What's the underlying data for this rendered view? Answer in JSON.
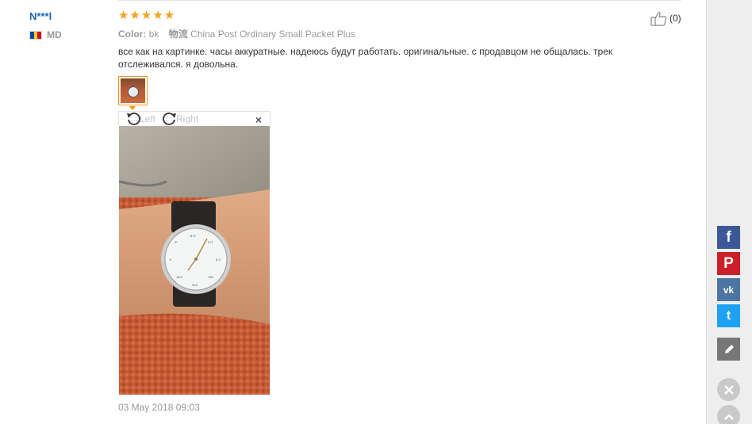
{
  "buyer": {
    "name": "N***l",
    "country_code": "MD",
    "flag_colors": [
      "#0046ae",
      "#ffd200",
      "#cc092f"
    ]
  },
  "review": {
    "rating": 5,
    "stars": [
      "★",
      "★",
      "★",
      "★",
      "★"
    ],
    "color_label": "Color:",
    "color_value": "bk",
    "shipping_label": "物流",
    "shipping_value": "China Post Ordinary Small Packet Plus",
    "text": "все как на картинке. часы аккуратные. надеюсь будут работать. оригинальные. с продавцом не общалась. трек отслеживался. я довольна.",
    "date": "03 May 2018 09:03"
  },
  "helpful": {
    "count": "(0)",
    "icon": "thumbs-up-icon"
  },
  "viewer": {
    "rotate_left_label": "Left",
    "rotate_right_label": "Right",
    "close_glyph": "×"
  },
  "share": {
    "facebook": "f",
    "pinterest": "P",
    "vk": "vk",
    "twitter": "t"
  },
  "colors": {
    "star": "#f4a11a",
    "buyer_name": "#1a66b3",
    "thumb_border": "#f09619",
    "facebook": "#3b5998",
    "pinterest": "#cb2027",
    "vk": "#4c75a3",
    "twitter": "#1da1f2"
  }
}
